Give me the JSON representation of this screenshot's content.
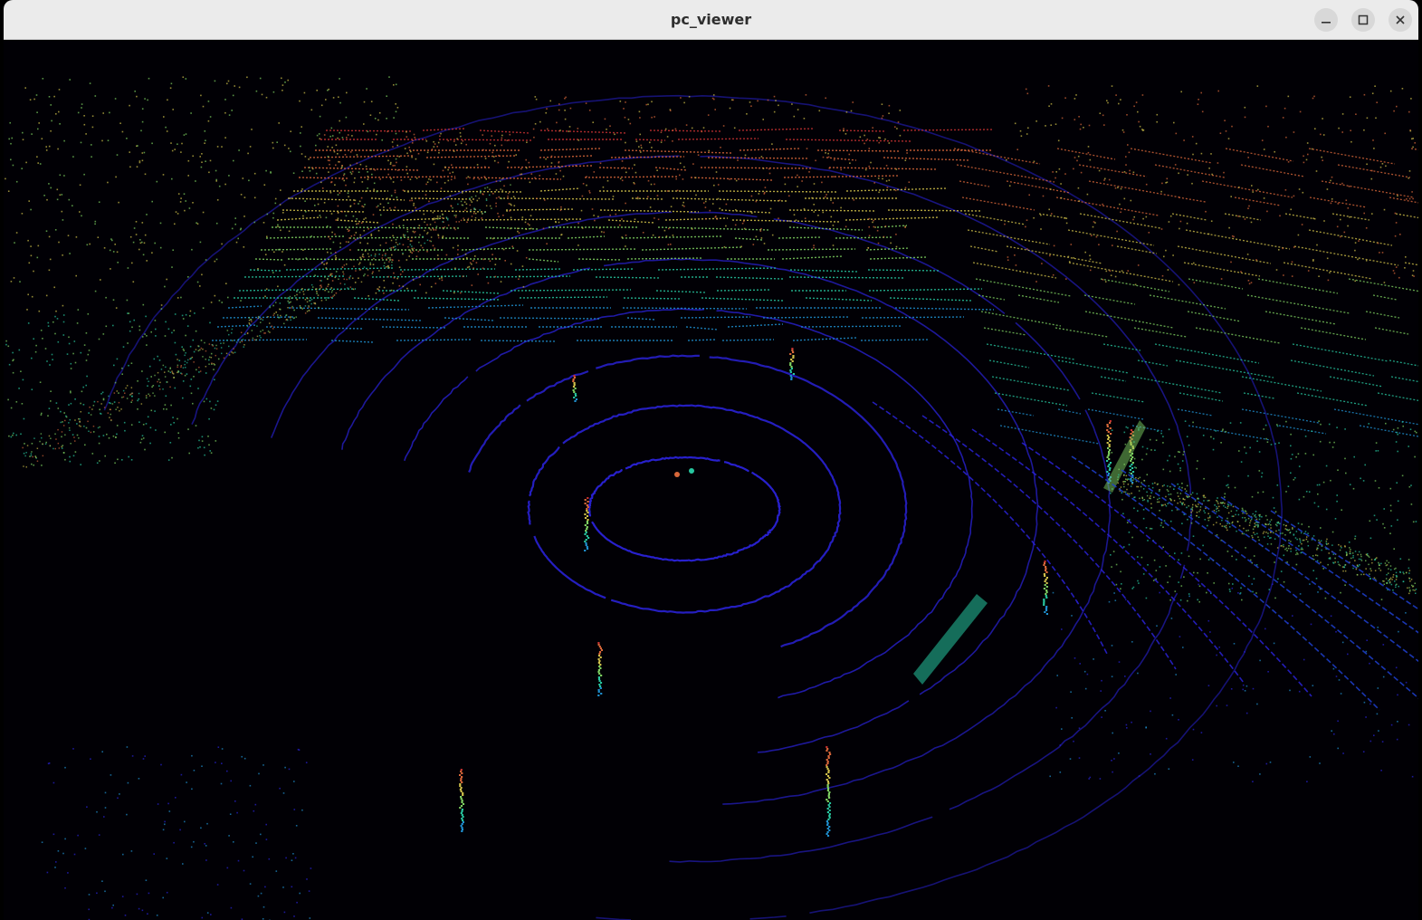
{
  "window": {
    "title": "pc_viewer"
  },
  "controls": {
    "minimize_icon": "minimize-icon",
    "maximize_icon": "maximize-icon",
    "close_icon": "close-icon"
  },
  "viewport": {
    "background": "#010005",
    "ring_color": "#2a22d8",
    "colormap": [
      "#2a22d8",
      "#1f8fd0",
      "#27c6a0",
      "#7ed061",
      "#d0c04a",
      "#d8673a",
      "#c83232"
    ]
  }
}
